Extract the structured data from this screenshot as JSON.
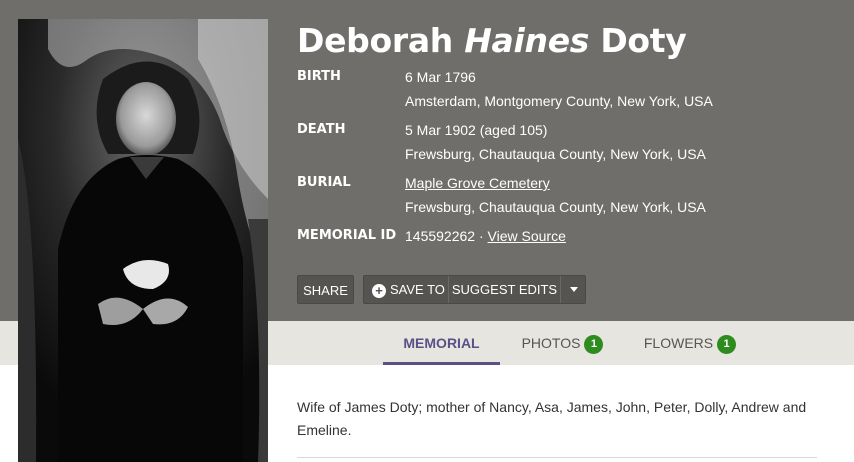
{
  "person": {
    "first_name": "Deborah",
    "middle_name": "Haines",
    "last_name": "Doty"
  },
  "facts": {
    "birth": {
      "label": "BIRTH",
      "date": "6 Mar 1796",
      "place": "Amsterdam, Montgomery County, New York, USA"
    },
    "death": {
      "label": "DEATH",
      "date": "5 Mar 1902 (aged 105)",
      "place": "Frewsburg, Chautauqua County, New York, USA"
    },
    "burial": {
      "label": "BURIAL",
      "cemetery": "Maple Grove Cemetery",
      "place": "Frewsburg, Chautauqua County, New York, USA"
    },
    "memorial": {
      "label": "MEMORIAL ID",
      "id": "145592262",
      "separator": " · ",
      "source_link": "View Source"
    }
  },
  "actions": {
    "share": "SHARE",
    "save_to": "SAVE TO",
    "suggest_edits": "SUGGEST EDITS"
  },
  "tabs": [
    {
      "label": "MEMORIAL",
      "active": true
    },
    {
      "label": "PHOTOS",
      "count": "1"
    },
    {
      "label": "FLOWERS",
      "count": "1"
    }
  ],
  "bio": "Wife of James Doty; mother of Nancy, Asa, James, John, Peter, Dolly, Andrew and Emeline.",
  "colors": {
    "header_bg": "#6f6e6a",
    "tab_active": "#5c5086",
    "badge": "#2e8b1e"
  }
}
